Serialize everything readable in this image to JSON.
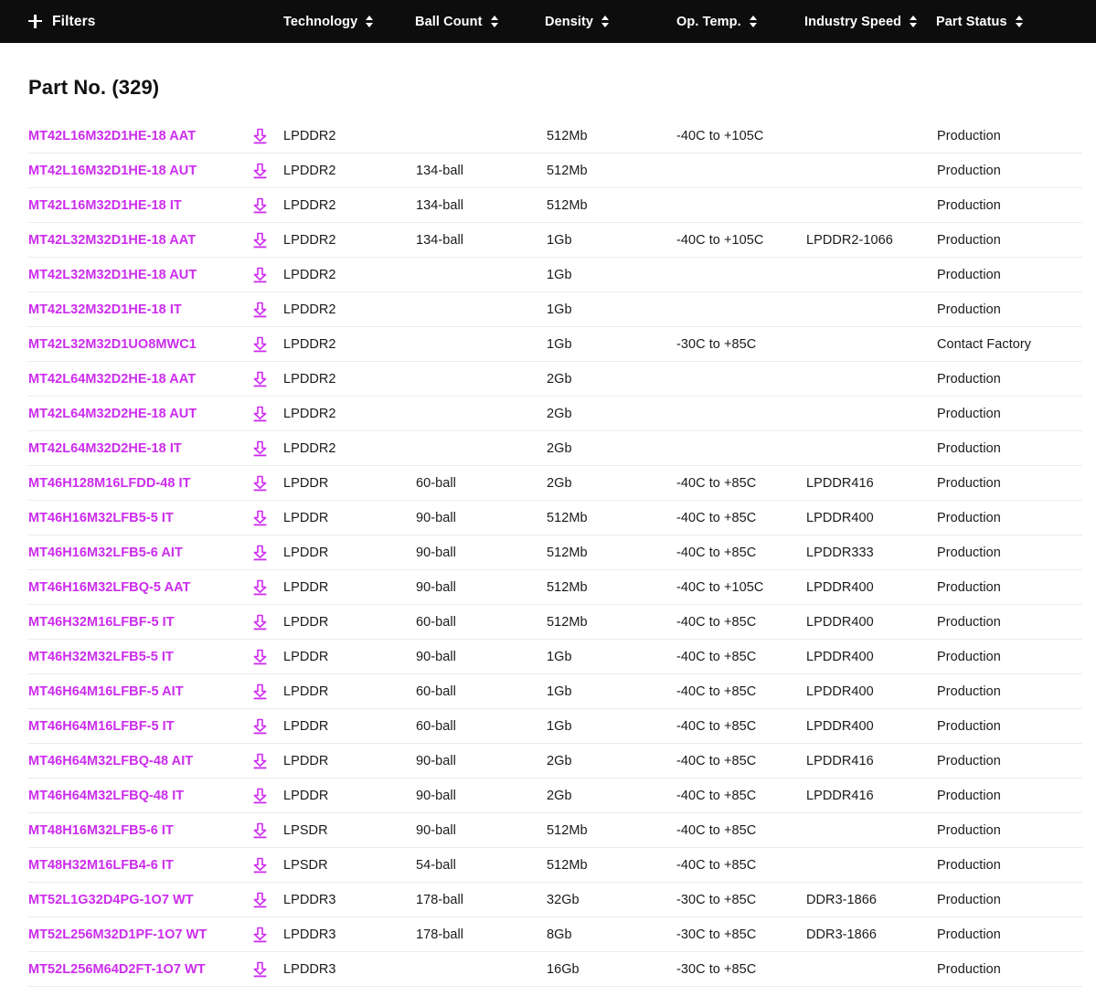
{
  "toolbar": {
    "filters_label": "Filters",
    "filters_icon": "plus-icon",
    "sort_icon": "sort-updown-icon",
    "columns": [
      {
        "label": "Technology"
      },
      {
        "label": "Ball Count"
      },
      {
        "label": "Density"
      },
      {
        "label": "Op. Temp."
      },
      {
        "label": "Industry Speed"
      },
      {
        "label": "Part Status"
      }
    ]
  },
  "main": {
    "title": "Part No. (329)",
    "download_icon": "download-icon",
    "link_color": "#cc2ced",
    "header_bg": "#0d0d0d",
    "row_border_color": "#ebebeb",
    "rows": [
      {
        "part": "MT42L16M32D1HE-18 AAT",
        "tech": "LPDDR2",
        "ball": "",
        "density": "512Mb",
        "optemp": "-40C to +105C",
        "speed": "",
        "status": "Production"
      },
      {
        "part": "MT42L16M32D1HE-18 AUT",
        "tech": "LPDDR2",
        "ball": "134-ball",
        "density": "512Mb",
        "optemp": "",
        "speed": "",
        "status": "Production"
      },
      {
        "part": "MT42L16M32D1HE-18 IT",
        "tech": "LPDDR2",
        "ball": "134-ball",
        "density": "512Mb",
        "optemp": "",
        "speed": "",
        "status": "Production"
      },
      {
        "part": "MT42L32M32D1HE-18 AAT",
        "tech": "LPDDR2",
        "ball": "134-ball",
        "density": "1Gb",
        "optemp": "-40C to +105C",
        "speed": "LPDDR2-1066",
        "status": "Production"
      },
      {
        "part": "MT42L32M32D1HE-18 AUT",
        "tech": "LPDDR2",
        "ball": "",
        "density": "1Gb",
        "optemp": "",
        "speed": "",
        "status": "Production"
      },
      {
        "part": "MT42L32M32D1HE-18 IT",
        "tech": "LPDDR2",
        "ball": "",
        "density": "1Gb",
        "optemp": "",
        "speed": "",
        "status": "Production"
      },
      {
        "part": "MT42L32M32D1UO8MWC1",
        "tech": "LPDDR2",
        "ball": "",
        "density": "1Gb",
        "optemp": "-30C to +85C",
        "speed": "",
        "status": "Contact Factory"
      },
      {
        "part": "MT42L64M32D2HE-18 AAT",
        "tech": "LPDDR2",
        "ball": "",
        "density": "2Gb",
        "optemp": "",
        "speed": "",
        "status": "Production"
      },
      {
        "part": "MT42L64M32D2HE-18 AUT",
        "tech": "LPDDR2",
        "ball": "",
        "density": "2Gb",
        "optemp": "",
        "speed": "",
        "status": "Production"
      },
      {
        "part": "MT42L64M32D2HE-18 IT",
        "tech": "LPDDR2",
        "ball": "",
        "density": "2Gb",
        "optemp": "",
        "speed": "",
        "status": "Production"
      },
      {
        "part": "MT46H128M16LFDD-48 IT",
        "tech": "LPDDR",
        "ball": "60-ball",
        "density": "2Gb",
        "optemp": "-40C to +85C",
        "speed": "LPDDR416",
        "status": "Production"
      },
      {
        "part": "MT46H16M32LFB5-5 IT",
        "tech": "LPDDR",
        "ball": "90-ball",
        "density": "512Mb",
        "optemp": "-40C to +85C",
        "speed": "LPDDR400",
        "status": "Production"
      },
      {
        "part": "MT46H16M32LFB5-6 AIT",
        "tech": "LPDDR",
        "ball": "90-ball",
        "density": "512Mb",
        "optemp": "-40C to +85C",
        "speed": "LPDDR333",
        "status": "Production"
      },
      {
        "part": "MT46H16M32LFBQ-5 AAT",
        "tech": "LPDDR",
        "ball": "90-ball",
        "density": "512Mb",
        "optemp": "-40C to +105C",
        "speed": "LPDDR400",
        "status": "Production"
      },
      {
        "part": "MT46H32M16LFBF-5 IT",
        "tech": "LPDDR",
        "ball": "60-ball",
        "density": "512Mb",
        "optemp": "-40C to +85C",
        "speed": "LPDDR400",
        "status": "Production"
      },
      {
        "part": "MT46H32M32LFB5-5 IT",
        "tech": "LPDDR",
        "ball": "90-ball",
        "density": "1Gb",
        "optemp": "-40C to +85C",
        "speed": "LPDDR400",
        "status": "Production"
      },
      {
        "part": "MT46H64M16LFBF-5 AIT",
        "tech": "LPDDR",
        "ball": "60-ball",
        "density": "1Gb",
        "optemp": "-40C to +85C",
        "speed": "LPDDR400",
        "status": "Production"
      },
      {
        "part": "MT46H64M16LFBF-5 IT",
        "tech": "LPDDR",
        "ball": "60-ball",
        "density": "1Gb",
        "optemp": "-40C to +85C",
        "speed": "LPDDR400",
        "status": "Production"
      },
      {
        "part": "MT46H64M32LFBQ-48 AIT",
        "tech": "LPDDR",
        "ball": "90-ball",
        "density": "2Gb",
        "optemp": "-40C to +85C",
        "speed": "LPDDR416",
        "status": "Production"
      },
      {
        "part": "MT46H64M32LFBQ-48 IT",
        "tech": "LPDDR",
        "ball": "90-ball",
        "density": "2Gb",
        "optemp": "-40C to +85C",
        "speed": "LPDDR416",
        "status": "Production"
      },
      {
        "part": "MT48H16M32LFB5-6 IT",
        "tech": "LPSDR",
        "ball": "90-ball",
        "density": "512Mb",
        "optemp": "-40C to +85C",
        "speed": "",
        "status": "Production"
      },
      {
        "part": "MT48H32M16LFB4-6 IT",
        "tech": "LPSDR",
        "ball": "54-ball",
        "density": "512Mb",
        "optemp": "-40C to +85C",
        "speed": "",
        "status": "Production"
      },
      {
        "part": "MT52L1G32D4PG-1O7 WT",
        "tech": "LPDDR3",
        "ball": "178-ball",
        "density": "32Gb",
        "optemp": "-30C to +85C",
        "speed": "DDR3-1866",
        "status": "Production"
      },
      {
        "part": "MT52L256M32D1PF-1O7 WT",
        "tech": "LPDDR3",
        "ball": "178-ball",
        "density": "8Gb",
        "optemp": "-30C to +85C",
        "speed": "DDR3-1866",
        "status": "Production"
      },
      {
        "part": "MT52L256M64D2FT-1O7 WT",
        "tech": "LPDDR3",
        "ball": "",
        "density": "16Gb",
        "optemp": "-30C to +85C",
        "speed": "",
        "status": "Production"
      }
    ]
  }
}
